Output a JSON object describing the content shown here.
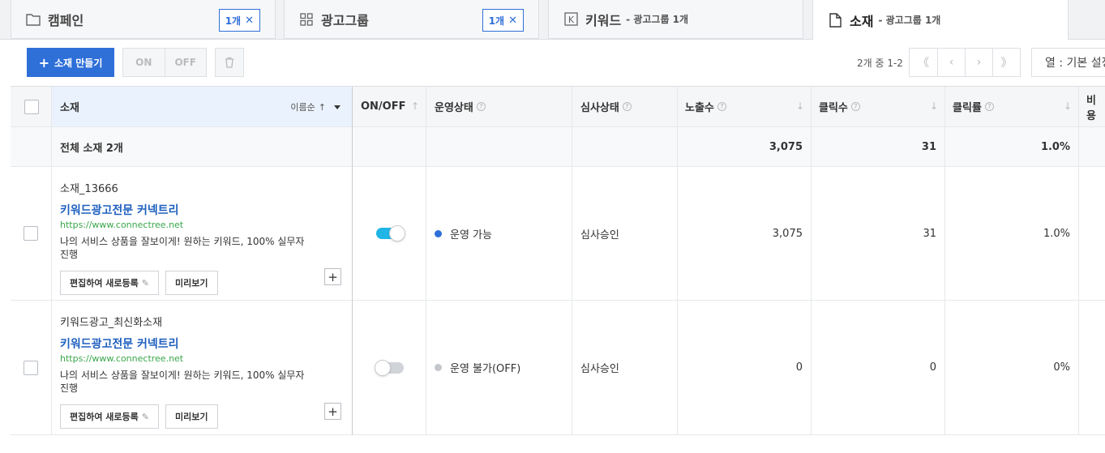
{
  "tabs": [
    {
      "label": "캠페인",
      "badge": "1개",
      "icon": "folder-icon"
    },
    {
      "label": "광고그룹",
      "badge": "1개",
      "icon": "grid-icon"
    },
    {
      "label": "키워드",
      "sub": "- 광고그룹 1개",
      "icon": "keyword-k-icon"
    },
    {
      "label": "소재",
      "sub": "- 광고그룹 1개",
      "icon": "document-icon"
    }
  ],
  "toolbar": {
    "create_label": "소재 만들기",
    "on_label": "ON",
    "off_label": "OFF",
    "page_info": "2개 중 1-2",
    "pager": [
      "《",
      "‹",
      "›",
      "》"
    ],
    "column_setting": "열 : 기본 설정"
  },
  "table": {
    "headers": {
      "ad": "소재",
      "sort_label": "이름순",
      "onoff": "ON/OFF",
      "run_status": "운영상태",
      "review_status": "심사상태",
      "impressions": "노출수",
      "clicks": "클릭수",
      "ctr": "클릭률",
      "cost": "비용"
    },
    "summary": {
      "label": "전체 소재 2개",
      "impressions": "3,075",
      "clicks": "31",
      "ctr": "1.0%"
    },
    "rows": [
      {
        "name": "소재_13666",
        "title": "키워드광고전문 커넥트리",
        "url": "https://www.connectree.net",
        "desc": "나의 서비스 상품을 잘보이게! 원하는 키워드, 100% 실무자 진행",
        "edit_label": "편집하여 새로등록",
        "preview_label": "미리보기",
        "toggle": "on",
        "run_status": "운영 가능",
        "run_color": "#2f6fd8",
        "review_status": "심사승인",
        "impressions": "3,075",
        "clicks": "31",
        "ctr": "1.0%"
      },
      {
        "name": "키워드광고_최신화소재",
        "title": "키워드광고전문 커넥트리",
        "url": "https://www.connectree.net",
        "desc": "나의 서비스 상품을 잘보이게! 원하는 키워드, 100% 실무자 진행",
        "edit_label": "편집하여 새로등록",
        "preview_label": "미리보기",
        "toggle": "off",
        "run_status": "운영 불가(OFF)",
        "run_color": "#c4c7cb",
        "review_status": "심사승인",
        "impressions": "0",
        "clicks": "0",
        "ctr": "0%"
      }
    ]
  },
  "colors": {
    "accent": "#2f6fd8",
    "toggle_on": "#1fb5e6",
    "url_green": "#3aa64b",
    "title_blue": "#1e5fbf"
  }
}
